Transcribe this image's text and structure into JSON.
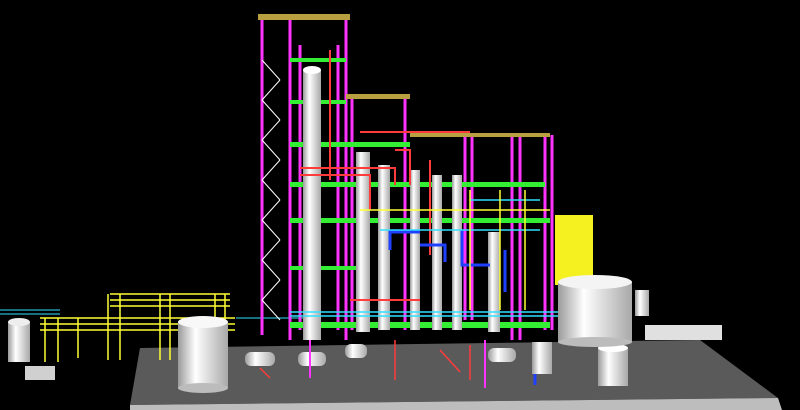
{
  "scene": {
    "background": "#000000",
    "ground_color": "#5e5e5e",
    "ground_edge_color": "#7a7a7a",
    "pad_color": "#d8d8d8",
    "steel_color": "#ff33ff",
    "platform_color": "#33ee33",
    "pipe_yellow": "#ffff33",
    "pipe_red": "#ff3b3b",
    "pipe_blue": "#2040ff",
    "pipe_cyan": "#30e0ff",
    "vessel_color": "#f2f2f2",
    "vessel_shade": "#b8b8b8",
    "grating_color": "#b8a040",
    "building_color": "#f5f020",
    "icons": [
      "process-plant-3d-model",
      "column-tower",
      "storage-tank",
      "pipe-rack"
    ]
  }
}
